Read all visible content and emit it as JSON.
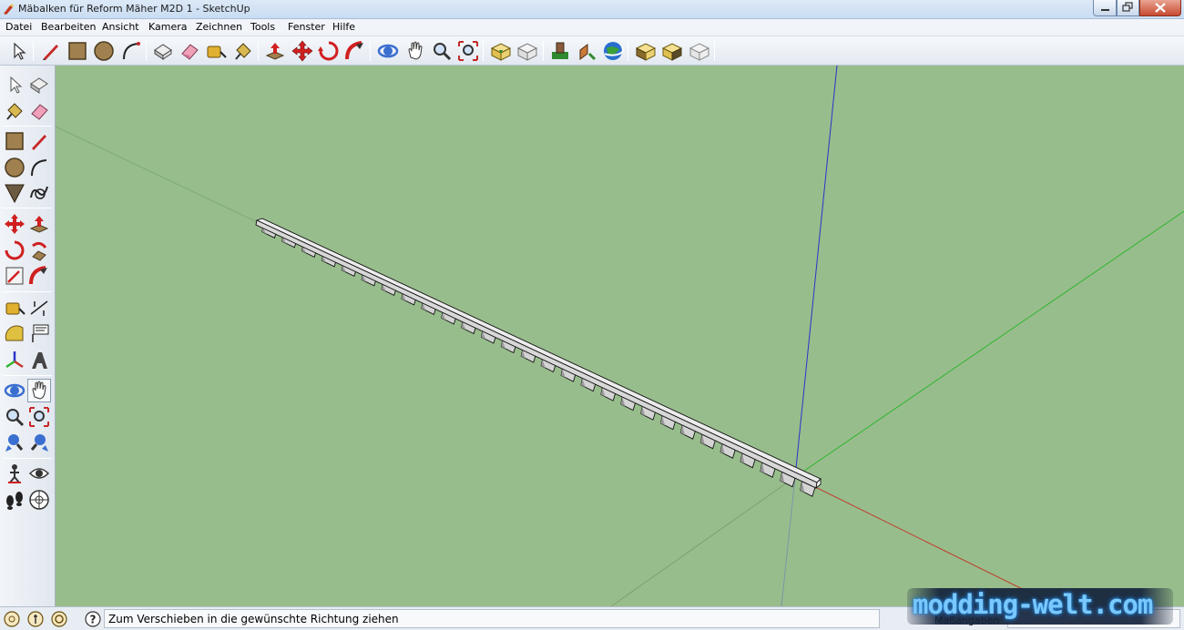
{
  "window": {
    "title": "Mäbalken für Reform Mäher M2D 1 - SketchUp"
  },
  "menu": [
    {
      "label": "Datei"
    },
    {
      "label": "Bearbeiten"
    },
    {
      "label": "Ansicht"
    },
    {
      "label": "Kamera"
    },
    {
      "label": "Zeichnen"
    },
    {
      "label": "Tools"
    },
    {
      "label": "Fenster"
    },
    {
      "label": "Hilfe"
    }
  ],
  "toolbar_icons": [
    "select-icon",
    "pencil-icon",
    "rectangle-icon",
    "circle-icon",
    "arc-icon",
    "make-component-icon",
    "eraser-icon",
    "tape-measure-icon",
    "paint-bucket-icon",
    "push-pull-icon",
    "move-icon",
    "rotate-icon",
    "follow-me-icon",
    "orbit-icon",
    "pan-icon",
    "zoom-icon",
    "zoom-extents-icon",
    "get-models-icon",
    "share-model-icon",
    "add-location-icon",
    "toggle-terrain-icon",
    "google-earth-icon",
    "get-models-2-icon",
    "share-component-icon",
    "share-3d-icon"
  ],
  "left_toolbar_icons": [
    "select-icon",
    "make-component-icon",
    "paint-bucket-icon",
    "eraser-icon",
    "rectangle-icon",
    "line-icon",
    "circle-icon",
    "arc-icon",
    "polygon-icon",
    "freehand-icon",
    "move-icon",
    "push-pull-icon",
    "rotate-icon",
    "follow-me-icon",
    "scale-icon",
    "offset-icon",
    "tape-measure-icon",
    "dimension-icon",
    "protractor-icon",
    "text-icon",
    "axes-icon",
    "3d-text-icon",
    "orbit-icon",
    "pan-icon",
    "zoom-icon",
    "zoom-window-icon",
    "previous-view-icon",
    "next-view-icon",
    "position-camera-icon",
    "look-around-icon",
    "walk-icon",
    "section-plane-icon"
  ],
  "status": {
    "icons": [
      "geo-location-icon",
      "credits-icon",
      "user-icon"
    ],
    "help_icon": "help-icon",
    "message": "Zum Verschieben in die gewünschte Richtung ziehen",
    "measurements_label": "Maßangaben",
    "measurements_value": ""
  },
  "watermark": {
    "text": "modding-welt.com"
  },
  "colors": {
    "viewport_background": "#98bd8c",
    "axis_blue": "#2a33c8",
    "axis_green": "#2fb62f",
    "axis_red": "#c0392b",
    "model_face": "#f2f2f2",
    "model_edge": "#000000"
  }
}
